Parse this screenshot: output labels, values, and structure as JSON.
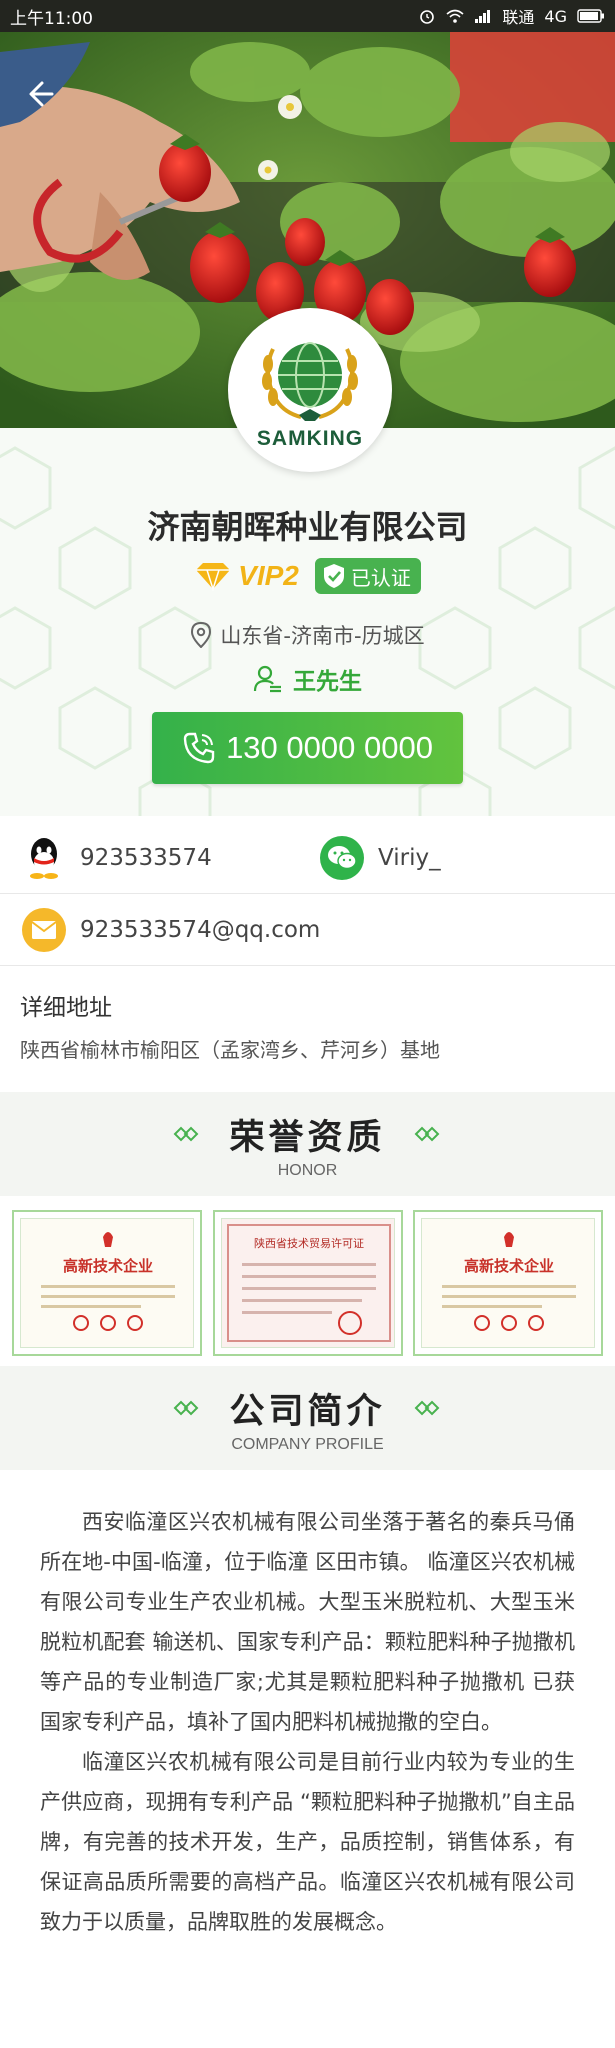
{
  "status_bar": {
    "time": "上午11:00",
    "carrier": "联通",
    "network": "4G"
  },
  "hero": {
    "back_icon": "back-arrow-icon"
  },
  "logo": {
    "text": "SAMKING"
  },
  "company": {
    "name": "济南朝晖种业有限公司",
    "vip_label": "VIP2",
    "verified_label": "已认证",
    "location": "山东省-济南市-历城区",
    "contact_person": "王先生",
    "phone": "130 0000 0000"
  },
  "contacts": {
    "qq": "923533574",
    "wechat": "Viriy_",
    "email": "923533574@qq.com"
  },
  "address": {
    "label": "详细地址",
    "value": "陕西省榆林市榆阳区（孟家湾乡、芹河乡）基地"
  },
  "honor": {
    "title": "荣誉资质",
    "subtitle": "HONOR"
  },
  "certificates": [
    {
      "title": "高新技术企业"
    },
    {
      "title": "陕西省技术贸易许可证"
    },
    {
      "title": "高新技术企业"
    }
  ],
  "profile": {
    "title": "公司简介",
    "subtitle": "COMPANY PROFILE",
    "paragraphs": [
      "西安临潼区兴农机械有限公司坐落于著名的秦兵马俑所在地-中国-临潼，位于临潼 区田市镇。 临潼区兴农机械有限公司专业生产农业机械。大型玉米脱粒机、大型玉米脱粒机配套 输送机、国家专利产品：颗粒肥料种子抛撒机等产品的专业制造厂家;尤其是颗粒肥料种子抛撒机 已获国家专利产品，填补了国内肥料机械抛撒的空白。",
      "临潼区兴农机械有限公司是目前行业内较为专业的生产供应商，现拥有专利产品 “颗粒肥料种子抛撒机”自主品牌，有完善的技术开发，生产，品质控制，销售体系，有保证高品质所需要的高档产品。临潼区兴农机械有限公司致力于以质量，品牌取胜的发展概念。"
    ]
  },
  "colors": {
    "accent_green": "#3cb24a",
    "vip_gold": "#f2b317",
    "qq_black": "#111111",
    "wechat_green": "#2fb34a",
    "email_yellow": "#f5b82a"
  }
}
